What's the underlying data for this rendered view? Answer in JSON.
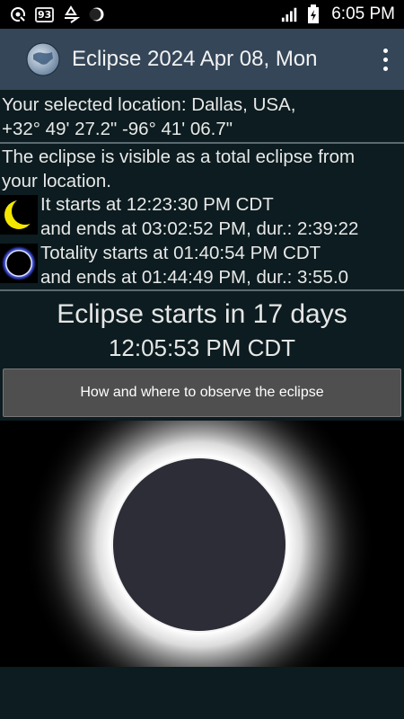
{
  "status_bar": {
    "time": "6:05 PM",
    "badge_number": "93",
    "icons": [
      "gps-icon",
      "recycle-icon",
      "moon-phase-icon",
      "signal-icon",
      "battery-charging-icon"
    ]
  },
  "app_bar": {
    "title": "Eclipse 2024 Apr 08, Mon",
    "logo": "globe-icon",
    "menu": "overflow-menu-icon"
  },
  "location": {
    "line1": "Your selected location: Dallas, USA,",
    "line2": "+32° 49' 27.2\"  -96° 41' 06.7\""
  },
  "visibility": {
    "line1": "The eclipse is visible as a total eclipse from",
    "line2": "your location."
  },
  "partial": {
    "icon": "crescent-moon-icon",
    "line1": "It starts at 12:23:30 PM CDT",
    "line2": "and ends at 03:02:52 PM, dur.:  2:39:22"
  },
  "totality": {
    "icon": "total-eclipse-icon",
    "line1": "Totality starts at 01:40:54 PM CDT",
    "line2": "and ends at 01:44:49 PM, dur.:  3:55.0"
  },
  "countdown": {
    "headline": "Eclipse starts in 17 days",
    "time": "12:05:53 PM CDT"
  },
  "observe_button": {
    "label": "How and where to observe the eclipse"
  },
  "colors": {
    "background": "#0c1c20",
    "app_bar": "#344658",
    "button": "#4f4f4f",
    "moon_disk": "#2c2d36",
    "crescent": "#f5e600"
  }
}
